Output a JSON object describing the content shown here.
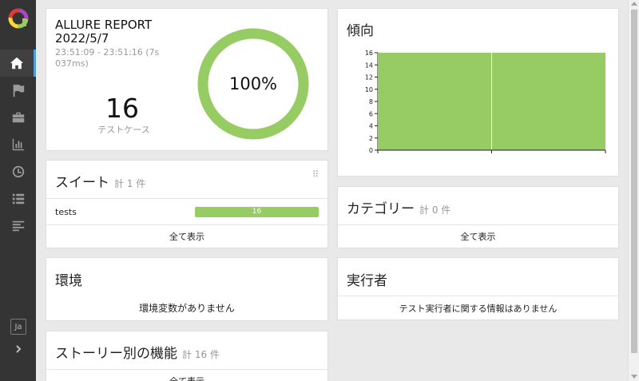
{
  "colors": {
    "passed": "#97cc64",
    "sidebar": "#343434",
    "active_accent": "#4d9de0"
  },
  "sidebar": {
    "items": [
      {
        "icon": "home-icon",
        "active": true
      },
      {
        "icon": "flag-icon",
        "active": false
      },
      {
        "icon": "briefcase-icon",
        "active": false
      },
      {
        "icon": "bar-chart-icon",
        "active": false
      },
      {
        "icon": "clock-icon",
        "active": false
      },
      {
        "icon": "list-icon",
        "active": false
      },
      {
        "icon": "align-left-icon",
        "active": false
      }
    ],
    "language": "Ja"
  },
  "summary": {
    "title_line1": "ALLURE REPORT",
    "title_line2": "2022/5/7",
    "time_range": "23:51:09 - 23:51:16 (7s 037ms)",
    "test_count": "16",
    "test_label": "テストケース",
    "percent": "100%",
    "pass_ratio": 1.0
  },
  "trend": {
    "title": "傾向",
    "chart_data": {
      "type": "area",
      "x": [
        "",
        ""
      ],
      "values": [
        16,
        16
      ],
      "ylim": [
        0,
        16
      ],
      "yticks": [
        "0",
        "2",
        "4",
        "6",
        "8",
        "10",
        "12",
        "14",
        "16"
      ],
      "xlabel": "",
      "ylabel": ""
    }
  },
  "suites": {
    "title": "スイート",
    "count": "計 1 件",
    "rows": [
      {
        "name": "tests",
        "value": "16",
        "ratio": 1.0
      }
    ],
    "show_all": "全て表示"
  },
  "categories": {
    "title": "カテゴリー",
    "count": "計 0 件",
    "show_all": "全て表示"
  },
  "environment": {
    "title": "環境",
    "message": "環境変数がありません"
  },
  "executors": {
    "title": "実行者",
    "message": "テスト実行者に関する情報はありません"
  },
  "features": {
    "title": "ストーリー別の機能",
    "count": "計 16 件",
    "show_all": "全て表示"
  }
}
